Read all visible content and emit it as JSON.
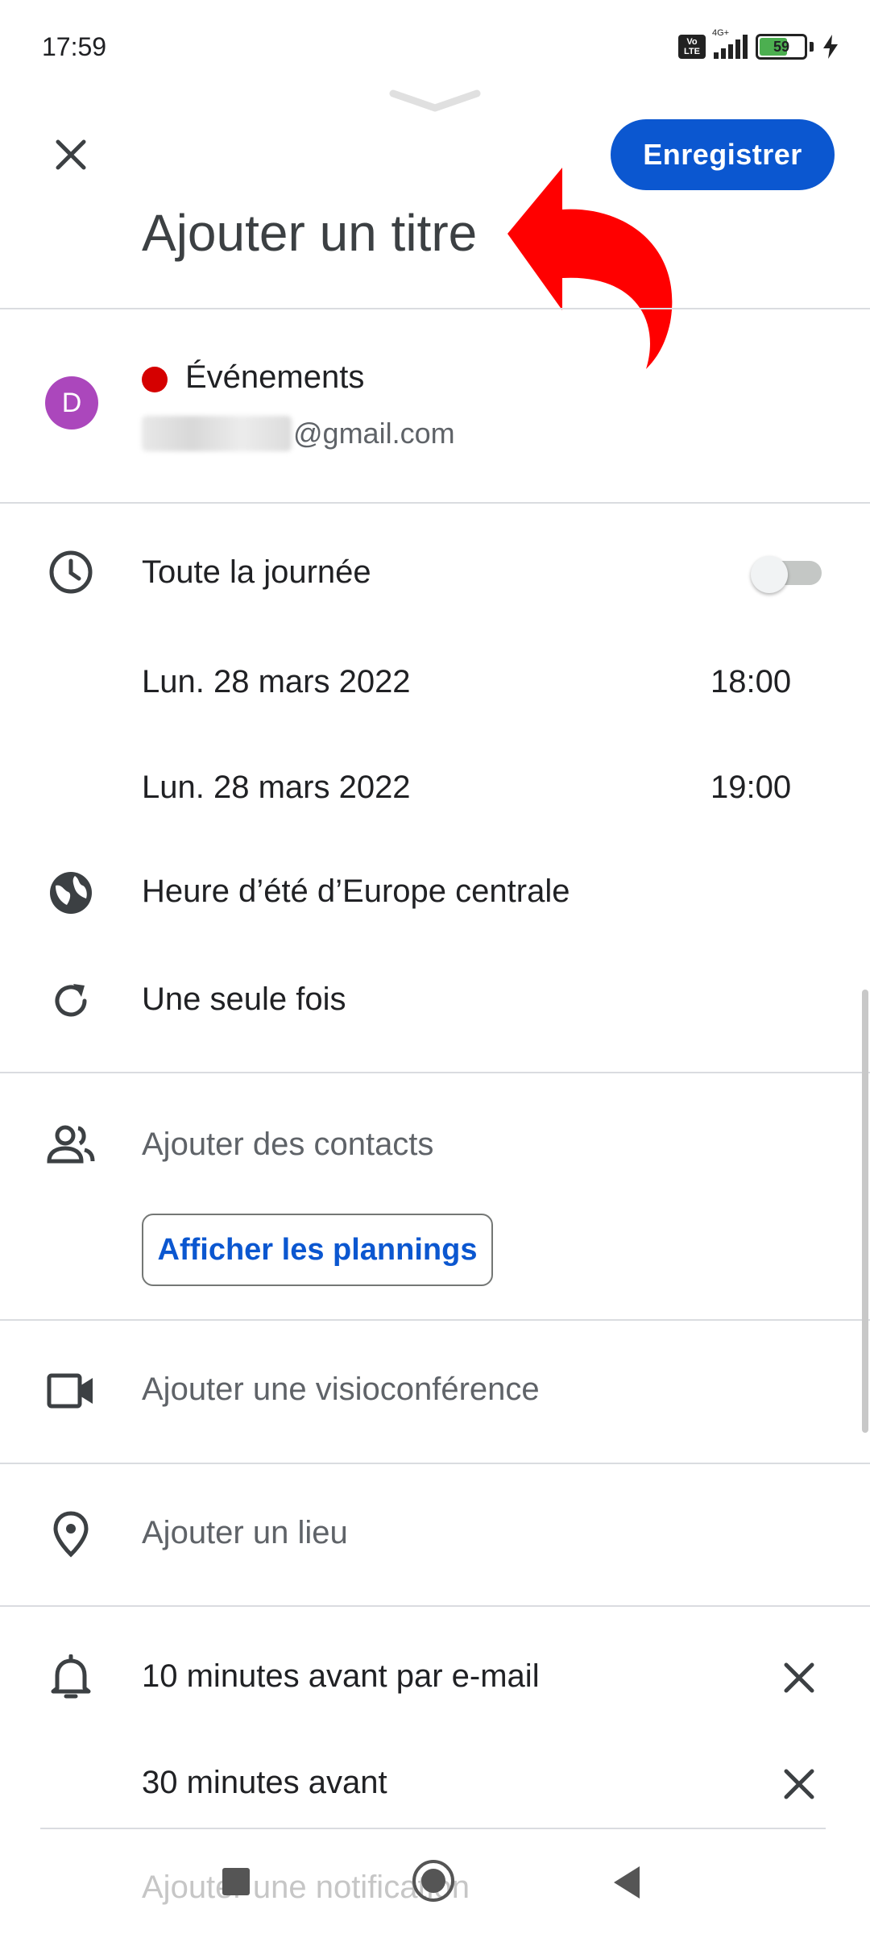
{
  "status_bar": {
    "time": "17:59",
    "volte_top": "Vo",
    "volte_bottom": "LTE",
    "network": "4G+",
    "battery": "59"
  },
  "header": {
    "save_label": "Enregistrer",
    "title_placeholder": "Ajouter un titre"
  },
  "calendar": {
    "avatar_letter": "D",
    "name": "Événements",
    "email_suffix": "@gmail.com",
    "color": "#d50000"
  },
  "time_section": {
    "all_day_label": "Toute la journée",
    "all_day_enabled": false,
    "start_date": "Lun. 28 mars 2022",
    "start_time": "18:00",
    "end_date": "Lun. 28 mars 2022",
    "end_time": "19:00",
    "timezone": "Heure d’été d’Europe centrale",
    "recurrence": "Une seule fois"
  },
  "guests": {
    "add_contacts": "Ajouter des contacts",
    "show_schedules": "Afficher les plannings"
  },
  "conference": {
    "label": "Ajouter une visioconférence"
  },
  "location": {
    "label": "Ajouter un lieu"
  },
  "notifications": {
    "items": [
      {
        "label": "10 minutes avant par e-mail"
      },
      {
        "label": "30 minutes avant"
      }
    ],
    "add_label": "Ajouter une notification"
  },
  "icons": {
    "close": "close-icon",
    "clock": "clock-icon",
    "globe": "globe-icon",
    "repeat": "repeat-icon",
    "people": "people-icon",
    "video": "videocam-icon",
    "pin": "location-pin-icon",
    "bell": "bell-icon"
  },
  "colors": {
    "accent": "#0b57d0",
    "avatar": "#ab47bc",
    "annotation_arrow": "#ff0000"
  }
}
